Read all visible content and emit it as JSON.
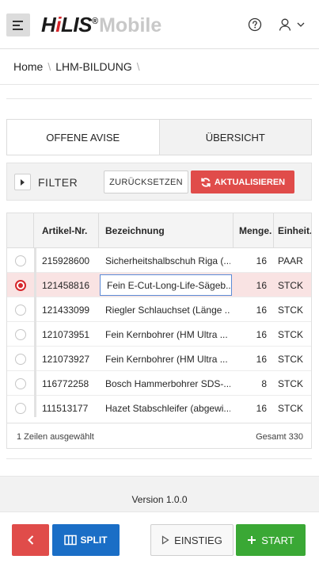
{
  "header": {
    "logo_hi": "H",
    "logo_i": "i",
    "logo_lis": "LIS",
    "logo_reg": "®",
    "logo_mobile": "Mobile"
  },
  "breadcrumb": {
    "items": [
      "Home",
      "LHM-BILDUNG"
    ],
    "separator": "\\"
  },
  "tabs": [
    {
      "label": "OFFENE AVISE",
      "active": true
    },
    {
      "label": "ÜBERSICHT",
      "active": false
    }
  ],
  "filter": {
    "label": "FILTER",
    "reset_label": "ZURÜCKSETZEN",
    "refresh_label": "AKTUALISIEREN"
  },
  "grid": {
    "columns": [
      "Artikel-Nr.",
      "Bezeichnung",
      "Menge.",
      "Einheit."
    ],
    "rows": [
      {
        "artikel": "215928600",
        "bezeichnung": "Sicherheitshalbschuh Riga (...",
        "menge": "16",
        "einheit": "PAAR",
        "selected": false
      },
      {
        "artikel": "121458816",
        "bezeichnung": "Fein E-Cut-Long-Life-Sägeb...",
        "menge": "16",
        "einheit": "STCK",
        "selected": true
      },
      {
        "artikel": "121433099",
        "bezeichnung": "Riegler Schlauchset (Länge ...",
        "menge": "16",
        "einheit": "STCK",
        "selected": false
      },
      {
        "artikel": "121073951",
        "bezeichnung": "Fein Kernbohrer (HM Ultra ...",
        "menge": "16",
        "einheit": "STCK",
        "selected": false
      },
      {
        "artikel": "121073927",
        "bezeichnung": "Fein Kernbohrer (HM Ultra ...",
        "menge": "16",
        "einheit": "STCK",
        "selected": false
      },
      {
        "artikel": "116772258",
        "bezeichnung": "Bosch Hammerbohrer SDS-...",
        "menge": "8",
        "einheit": "STCK",
        "selected": false
      },
      {
        "artikel": "111513177",
        "bezeichnung": "Hazet Stabschleifer (abgewi...",
        "menge": "16",
        "einheit": "STCK",
        "selected": false
      }
    ],
    "footer_selected": "1 Zeilen ausgewählt",
    "footer_total": "Gesamt 330"
  },
  "version": "Version 1.0.0",
  "buttons": {
    "split_label": "SPLIT",
    "einstieg_label": "EINSTIEG",
    "start_label": "START"
  },
  "colors": {
    "accent_red": "#e04c4a",
    "split_blue": "#1a6ec6",
    "start_green": "#3aa835",
    "selected_row": "#f9e3e3"
  },
  "icons": {
    "menu": "hamburger-icon",
    "help": "help-circle-icon",
    "user": "user-icon",
    "dropdown": "chevron-down-icon",
    "refresh": "refresh-icon",
    "back": "chevron-left-icon",
    "split": "columns-icon",
    "einstieg": "play-outline-icon",
    "start": "plus-icon"
  }
}
